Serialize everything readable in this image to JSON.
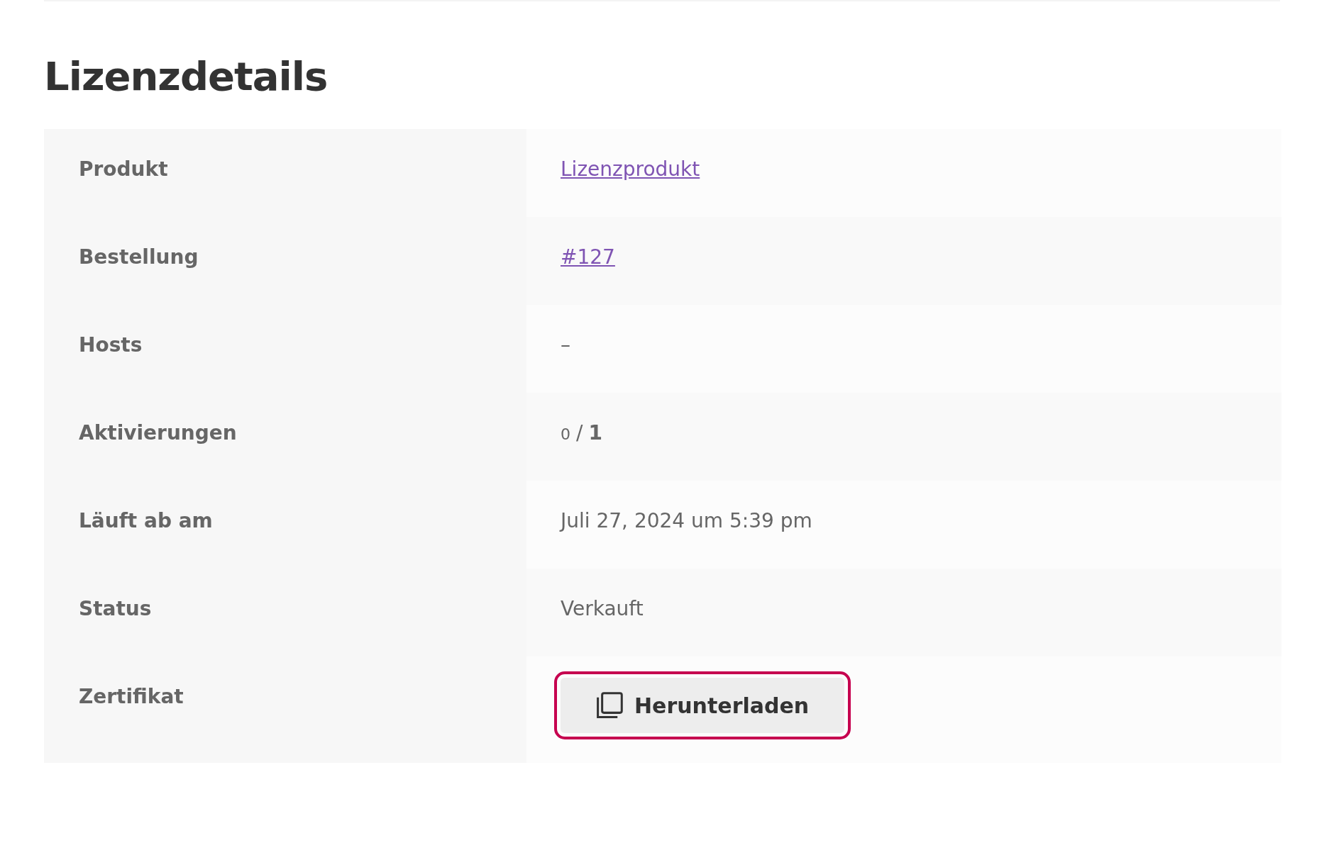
{
  "title": "Lizenzdetails",
  "rows": [
    {
      "label": "Produkt",
      "kind": "link",
      "value": "Lizenzprodukt"
    },
    {
      "label": "Bestellung",
      "kind": "link",
      "value": "#127"
    },
    {
      "label": "Hosts",
      "kind": "text",
      "value": "–"
    },
    {
      "label": "Aktivierungen",
      "kind": "activations",
      "used": "0",
      "separator": "/",
      "total": "1"
    },
    {
      "label": "Läuft ab am",
      "kind": "text",
      "value": "Juli 27, 2024 um 5:39 pm"
    },
    {
      "label": "Status",
      "kind": "text",
      "value": "Verkauft"
    },
    {
      "label": "Zertifikat",
      "kind": "button",
      "value": "Herunterladen",
      "focused": true
    }
  ]
}
